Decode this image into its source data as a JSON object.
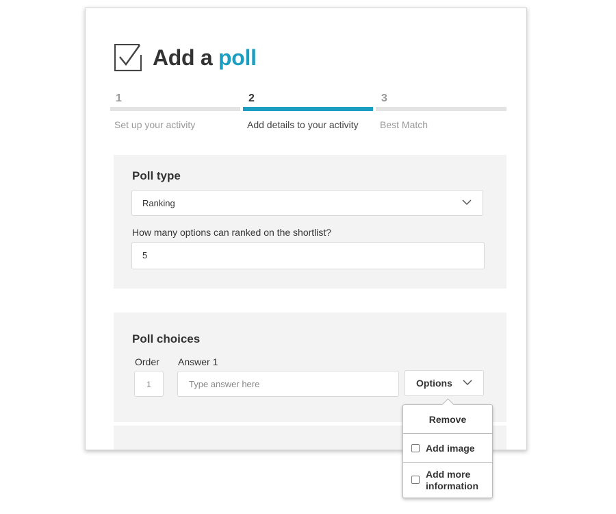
{
  "header": {
    "title_prefix": "Add a",
    "title_accent": "poll",
    "icon": "checkbox-checked-icon"
  },
  "stepper": {
    "steps": [
      {
        "number": "1",
        "label": "Set up your activity",
        "active": false
      },
      {
        "number": "2",
        "label": "Add details to your activity",
        "active": true
      },
      {
        "number": "3",
        "label": "Best Match",
        "active": false
      }
    ]
  },
  "poll_type": {
    "heading": "Poll type",
    "selected": "Ranking",
    "shortlist_label": "How many options can ranked on the shortlist?",
    "shortlist_value": "5"
  },
  "poll_choices": {
    "heading": "Poll choices",
    "order_label": "Order",
    "answer_label": "Answer 1",
    "order_value": "1",
    "answer_placeholder": "Type answer here",
    "options_label": "Options"
  },
  "options_menu": {
    "remove": "Remove",
    "add_image": "Add image",
    "add_more_line1": "Add more",
    "add_more_line2": "information"
  },
  "colors": {
    "accent": "#1c9ec0",
    "panel_bg": "#f3f3f3",
    "step_inactive": "#e3e3e3"
  }
}
